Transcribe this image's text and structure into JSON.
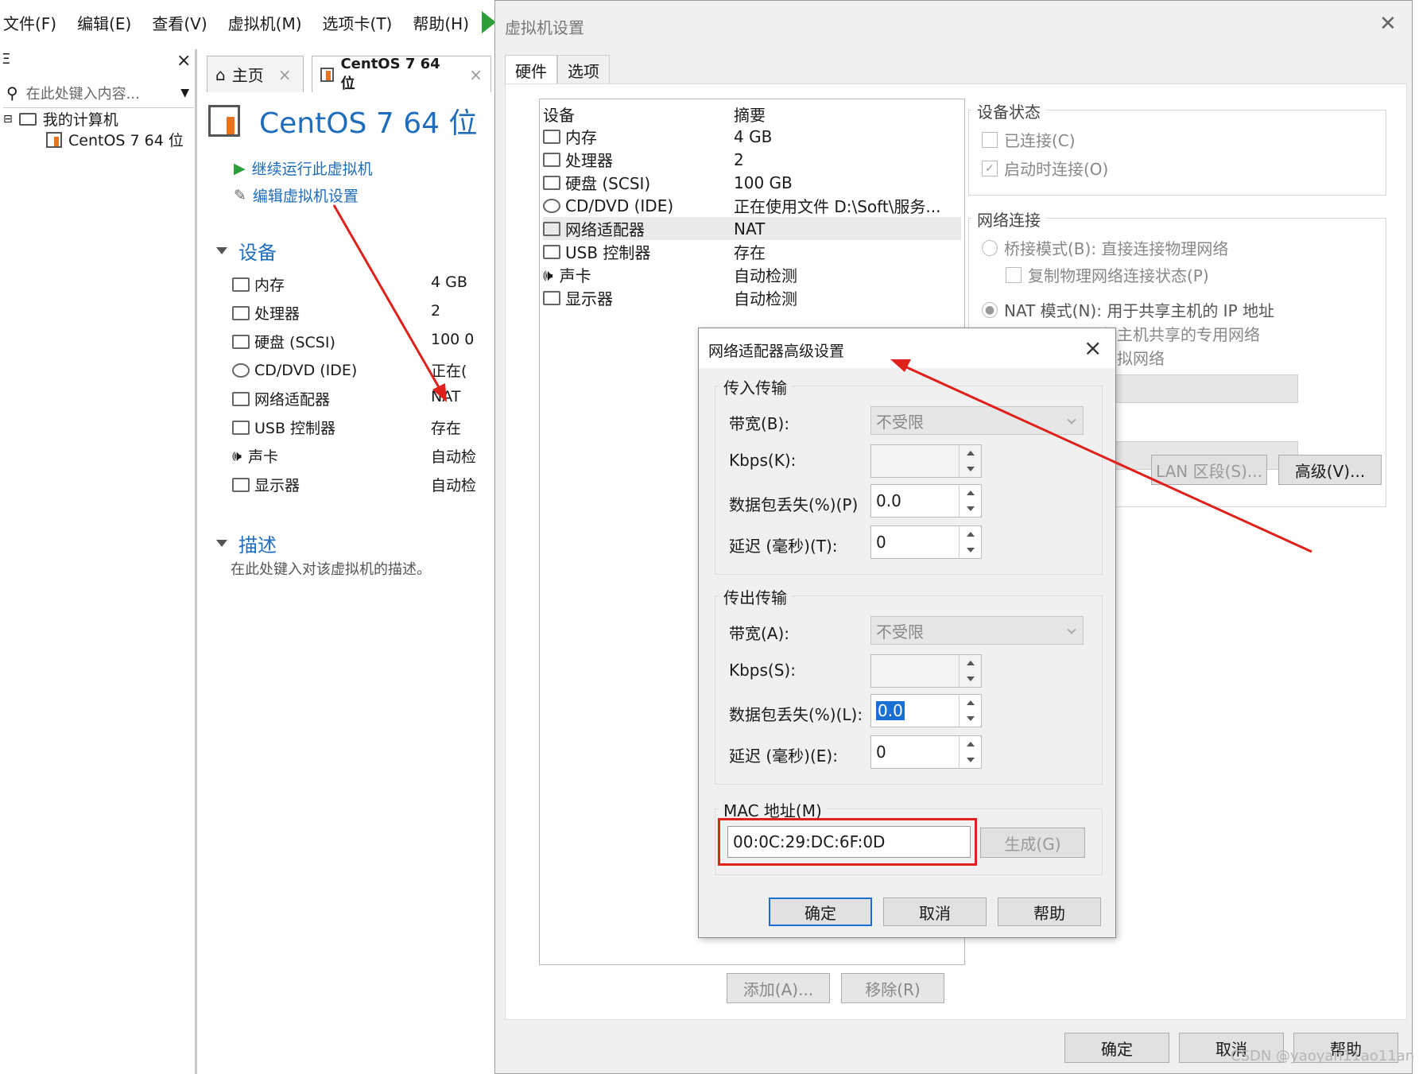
{
  "menu": [
    "文件(F)",
    "编辑(E)",
    "查看(V)",
    "虚拟机(M)",
    "选项卡(T)",
    "帮助(H)"
  ],
  "sidebar": {
    "head": "Ξ",
    "search_placeholder": "在此处键入内容...",
    "tree_root": "我的计算机",
    "tree_vm": "CentOS 7 64 位"
  },
  "content": {
    "tab_home": "主页",
    "tab_vm": "CentOS 7 64 位",
    "vm_title": "CentOS 7 64 位",
    "action_run": "继续运行此虚拟机",
    "action_edit": "编辑虚拟机设置",
    "section_devices": "设备",
    "devices": [
      {
        "name": "内存",
        "value": "4 GB"
      },
      {
        "name": "处理器",
        "value": "2"
      },
      {
        "name": "硬盘 (SCSI)",
        "value": "100 0"
      },
      {
        "name": "CD/DVD (IDE)",
        "value": "正在("
      },
      {
        "name": "网络适配器",
        "value": "NAT"
      },
      {
        "name": "USB 控制器",
        "value": "存在"
      },
      {
        "name": "声卡",
        "value": "自动检"
      },
      {
        "name": "显示器",
        "value": "自动检"
      }
    ],
    "section_desc": "描述",
    "desc_text": "在此处键入对该虚拟机的描述。"
  },
  "settings": {
    "title": "虚拟机设置",
    "tab_hardware": "硬件",
    "tab_options": "选项",
    "col_device": "设备",
    "col_summary": "摘要",
    "devices": [
      {
        "name": "内存",
        "summary": "4 GB"
      },
      {
        "name": "处理器",
        "summary": "2"
      },
      {
        "name": "硬盘 (SCSI)",
        "summary": "100 GB"
      },
      {
        "name": "CD/DVD (IDE)",
        "summary": "正在使用文件 D:\\Soft\\服务..."
      },
      {
        "name": "网络适配器",
        "summary": "NAT"
      },
      {
        "name": "USB 控制器",
        "summary": "存在"
      },
      {
        "name": "声卡",
        "summary": "自动检测"
      },
      {
        "name": "显示器",
        "summary": "自动检测"
      }
    ],
    "btn_add": "添加(A)...",
    "btn_remove": "移除(R)",
    "device_status": "设备状态",
    "connected": "已连接(C)",
    "connect_on_start": "启动时连接(O)",
    "network": "网络连接",
    "bridged": "桥接模式(B): 直接连接物理网络",
    "replicate": "复制物理网络连接状态(P)",
    "nat": "NAT 模式(N): 用于共享主机的 IP 地址",
    "hostonly": "与主机共享的专用网络",
    "custom": "虚拟网络",
    "btn_lan": "LAN 区段(S)...",
    "btn_advanced": "高级(V)...",
    "btn_ok": "确定",
    "btn_cancel": "取消",
    "btn_help": "帮助"
  },
  "advanced": {
    "title": "网络适配器高级设置",
    "incoming": "传入传输",
    "in_bandwidth_label": "带宽(B):",
    "in_bandwidth_value": "不受限",
    "in_kbps_label": "Kbps(K):",
    "in_kbps_value": "",
    "in_loss_label": "数据包丢失(%)(P)",
    "in_loss_value": "0.0",
    "in_latency_label": "延迟 (毫秒)(T):",
    "in_latency_value": "0",
    "outgoing": "传出传输",
    "out_bandwidth_label": "带宽(A):",
    "out_bandwidth_value": "不受限",
    "out_kbps_label": "Kbps(S):",
    "out_kbps_value": "",
    "out_loss_label": "数据包丢失(%)(L):",
    "out_loss_value": "0.0",
    "out_latency_label": "延迟 (毫秒)(E):",
    "out_latency_value": "0",
    "mac_label": "MAC 地址(M)",
    "mac_value": "00:0C:29:DC:6F:0D",
    "btn_generate": "生成(G)",
    "btn_ok": "确定",
    "btn_cancel": "取消",
    "btn_help": "帮助"
  },
  "watermark": "CSDN @yaoyan11ao11an",
  "colors": {
    "accent": "#1f6dbd",
    "annotation": "#e0201a"
  }
}
